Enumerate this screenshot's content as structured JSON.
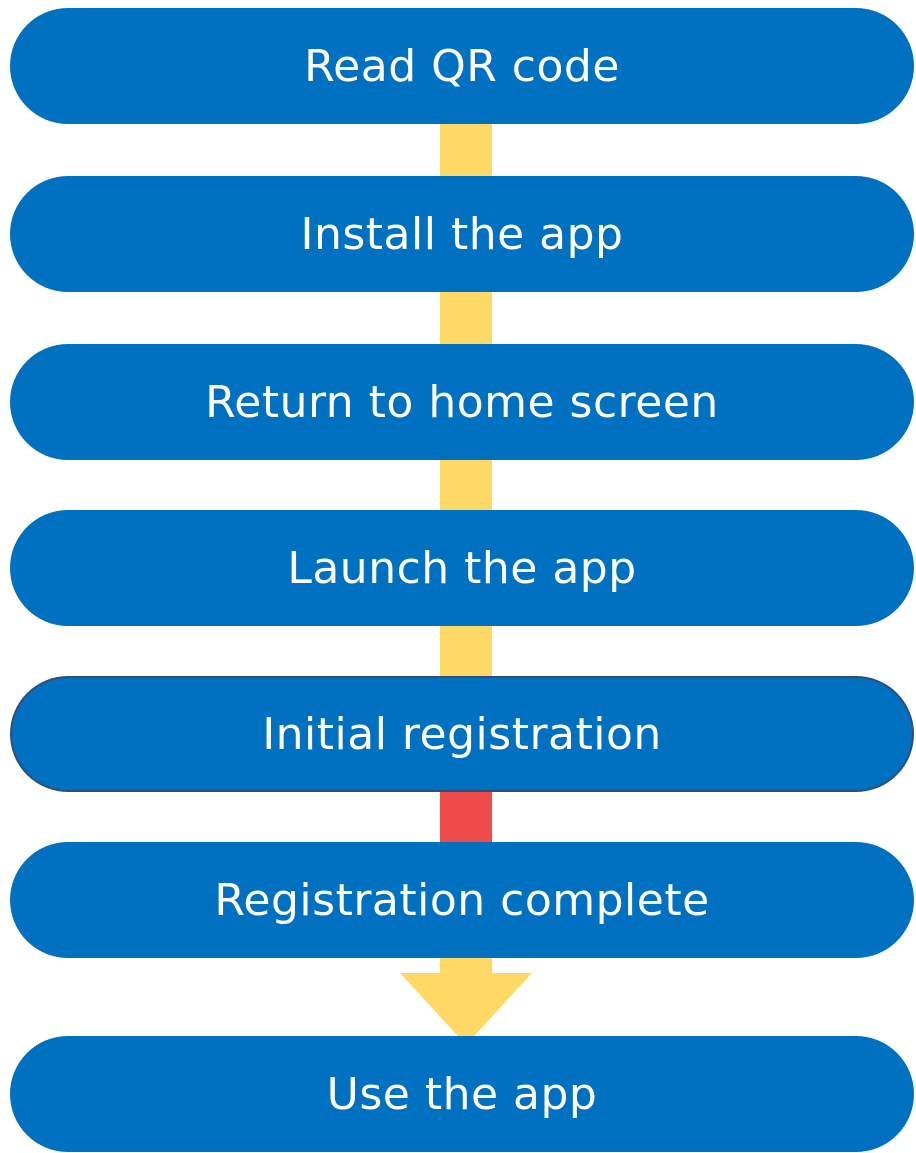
{
  "flow": {
    "steps": [
      {
        "label": "Read QR code"
      },
      {
        "label": "Install the app"
      },
      {
        "label": "Return to home screen"
      },
      {
        "label": "Launch the app"
      },
      {
        "label": "Initial registration"
      },
      {
        "label": "Registration complete"
      },
      {
        "label": "Use the app"
      }
    ],
    "colors": {
      "step_fill": "#0070c0",
      "step_text": "#ffffff",
      "connector": "#ffd966",
      "connector_alert": "#f04b4b",
      "arrow": "#ffd966"
    }
  }
}
